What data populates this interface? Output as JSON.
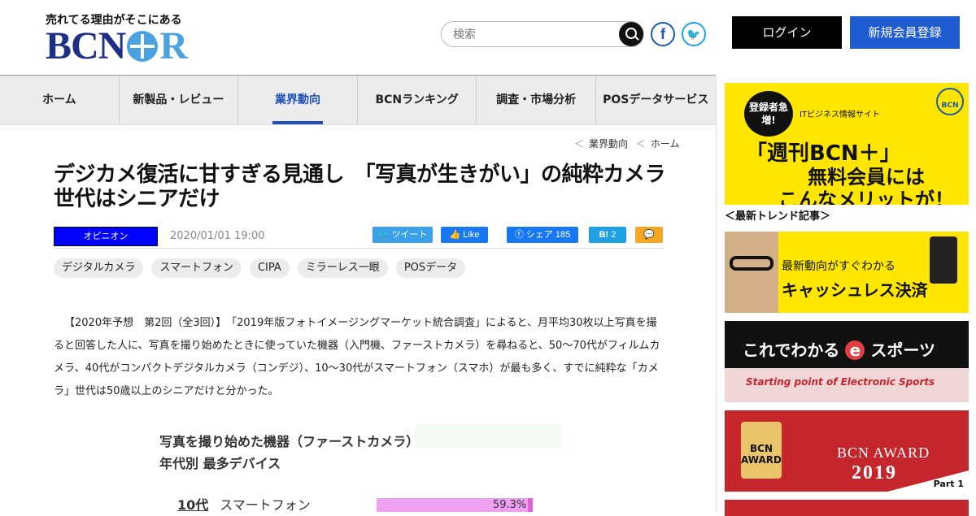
{
  "header": {
    "tagline": "売れてる理由がそこにある",
    "logo_left": "BCN",
    "logo_right": "R",
    "search_placeholder": "検索",
    "facebook_icon": "f",
    "twitter_icon": "t",
    "login_label": "ログイン",
    "register_label": "新規会員登録"
  },
  "nav": {
    "items": [
      {
        "label": "ホーム"
      },
      {
        "label": "新製品・レビュー"
      },
      {
        "label": "業界動向"
      },
      {
        "label": "BCNランキング"
      },
      {
        "label": "調査・市場分析"
      },
      {
        "label": "POSデータサービス"
      }
    ],
    "active_index": 2,
    "active_color": "#1f4fb8"
  },
  "breadcrumb": {
    "items": [
      "業界動向",
      "ホーム"
    ]
  },
  "article": {
    "title": "デジカメ復活に甘すぎる見通し　「写真が生きがい」の純粋カメラ世代はシニアだけ",
    "category": "オピニオン",
    "date": "2020/01/01 19:00",
    "share": {
      "tweet": "ツイート",
      "like": "Like",
      "facebook_share": "シェア 185",
      "hatena_label": "B!",
      "hatena_count": "2"
    },
    "tags": [
      "デジタルカメラ",
      "スマートフォン",
      "CIPA",
      "ミラーレス一眼",
      "POSデータ"
    ],
    "body": "【2020年予想　第2回（全3回）】　「2019年版フォトイメージングマーケット統合調査」によると、月平均30枚以上写真を撮ると回答した人に、写真を撮り始めたときに使っていた機器（入門機、ファーストカメラ）を尋ねると、50～70代がフィルムカメラ、40代がコンパクトデジタルカメラ（コンデジ）、10～30代がスマートフォン（スマホ）が最も多く、すでに純粋な「カメラ」世代は50歳以上のシニアだけと分かった。",
    "figure": {
      "title_line1": "写真を撮り始めた機器（ファーストカメラ）",
      "title_line2": "年代別 最多デバイス",
      "row_age": "10代",
      "row_device": "スマートフォン",
      "row_value": "59.3%",
      "row_fraction": 0.593
    }
  },
  "sidebar": {
    "banner1": {
      "badge": "登録者急増!",
      "small": "ITビジネス情報サイト",
      "line1": "「週刊BCN＋」",
      "line2": "無料会員には",
      "line3": "こんなメリットが！",
      "mark": "BCN"
    },
    "section_heading": "＜最新トレンド記事＞",
    "banner2": {
      "line1": "最新動向がすぐわかる",
      "line2": "キャッシュレス決済"
    },
    "banner3": {
      "line1_a": "これでわかる",
      "line1_e": "e",
      "line1_b": "スポーツ",
      "line2": "Starting point of Electronic Sports"
    },
    "banner4": {
      "medal": "BCN AWARD",
      "line1": "BCN AWARD",
      "line2": "2019",
      "part": "Part 1"
    }
  }
}
